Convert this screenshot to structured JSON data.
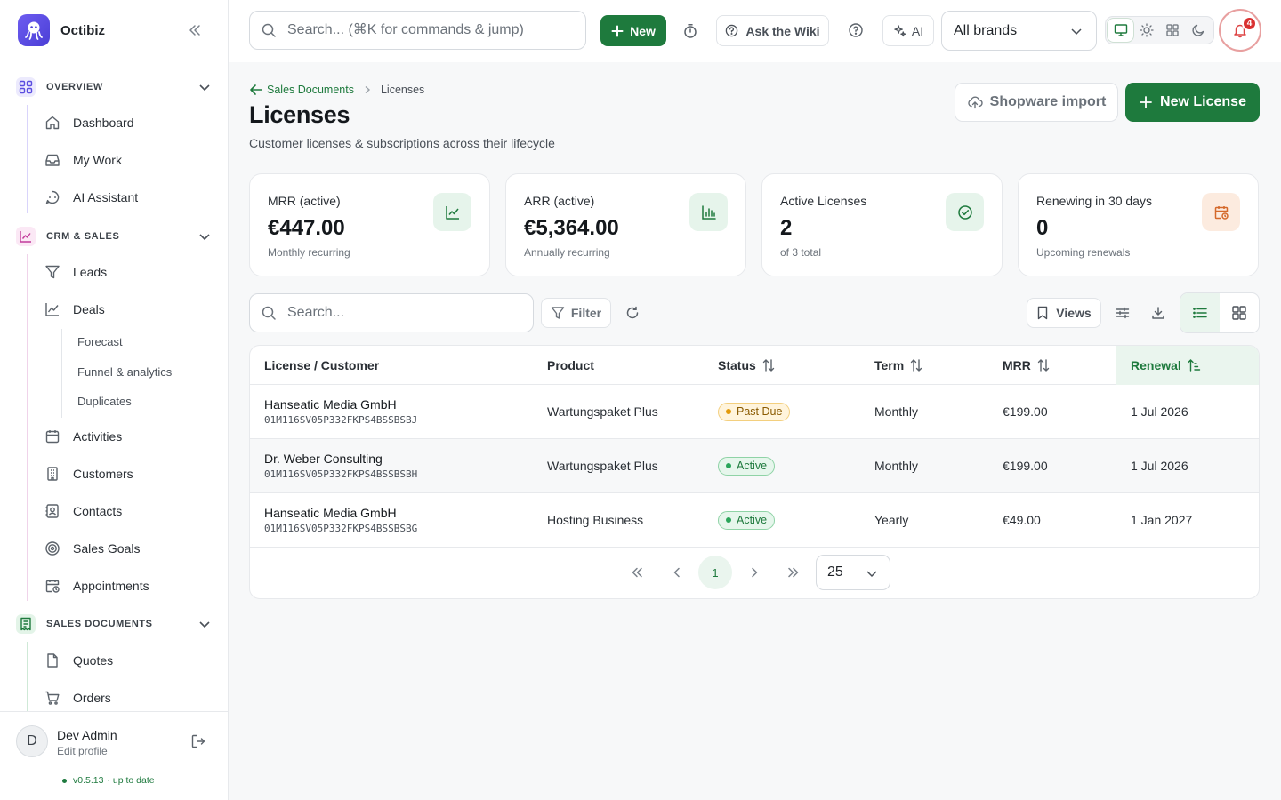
{
  "app": {
    "name": "Octibiz"
  },
  "sidebar": {
    "sections": [
      {
        "label": "OVERVIEW",
        "items": [
          "Dashboard",
          "My Work",
          "AI Assistant"
        ]
      },
      {
        "label": "CRM & SALES",
        "items": [
          "Leads",
          "Deals",
          "Activities",
          "Customers",
          "Contacts",
          "Sales Goals",
          "Appointments"
        ],
        "deals_sub": [
          "Forecast",
          "Funnel & analytics",
          "Duplicates"
        ]
      },
      {
        "label": "SALES DOCUMENTS",
        "items": [
          "Quotes",
          "Orders"
        ]
      }
    ],
    "profile": {
      "initial": "D",
      "name": "Dev Admin",
      "sub": "Edit profile",
      "version": "v0.5.13",
      "version_status": "· up to date"
    }
  },
  "topbar": {
    "search_placeholder": "Search... (⌘K for commands & jump)",
    "new_label": "New",
    "wiki_label": "Ask the Wiki",
    "ai_label": "AI",
    "brand_filter": "All brands",
    "notifications_count": "4"
  },
  "page": {
    "breadcrumb_parent": "Sales Documents",
    "breadcrumb_current": "Licenses",
    "title": "Licenses",
    "subtitle": "Customer licenses & subscriptions across their lifecycle",
    "import_label": "Shopware import",
    "new_license_label": "New License"
  },
  "kpis": [
    {
      "label": "MRR (active)",
      "value": "€447.00",
      "sub": "Monthly recurring",
      "icon": "trend-chart-icon",
      "color": "#1e7a3d"
    },
    {
      "label": "ARR (active)",
      "value": "€5,364.00",
      "sub": "Annually recurring",
      "icon": "bar-chart-icon",
      "color": "#1e7a3d"
    },
    {
      "label": "Active Licenses",
      "value": "2",
      "sub": "of 3 total",
      "icon": "check-circle-icon",
      "color": "#1e7a3d"
    },
    {
      "label": "Renewing in 30 days",
      "value": "0",
      "sub": "Upcoming renewals",
      "icon": "calendar-clock-icon",
      "color": "#d4692a"
    }
  ],
  "toolbar": {
    "search_placeholder": "Search...",
    "filter_label": "Filter",
    "views_label": "Views"
  },
  "table": {
    "columns": [
      "License / Customer",
      "Product",
      "Status",
      "Term",
      "MRR",
      "Renewal"
    ],
    "sorted_column": "Renewal",
    "rows": [
      {
        "customer": "Hanseatic Media GmbH",
        "license": "01M116SV05P332FKPS4BSSBSBJ",
        "product": "Wartungspaket Plus",
        "status": "Past Due",
        "status_kind": "pastdue",
        "term": "Monthly",
        "mrr": "€199.00",
        "renewal": "1 Jul 2026"
      },
      {
        "customer": "Dr. Weber Consulting",
        "license": "01M116SV05P332FKPS4BSSBSBH",
        "product": "Wartungspaket Plus",
        "status": "Active",
        "status_kind": "active",
        "term": "Monthly",
        "mrr": "€199.00",
        "renewal": "1 Jul 2026"
      },
      {
        "customer": "Hanseatic Media GmbH",
        "license": "01M116SV05P332FKPS4BSSBSBG",
        "product": "Hosting Business",
        "status": "Active",
        "status_kind": "active",
        "term": "Yearly",
        "mrr": "€49.00",
        "renewal": "1 Jan 2027"
      }
    ]
  },
  "pagination": {
    "current_page": "1",
    "page_size": "25"
  }
}
